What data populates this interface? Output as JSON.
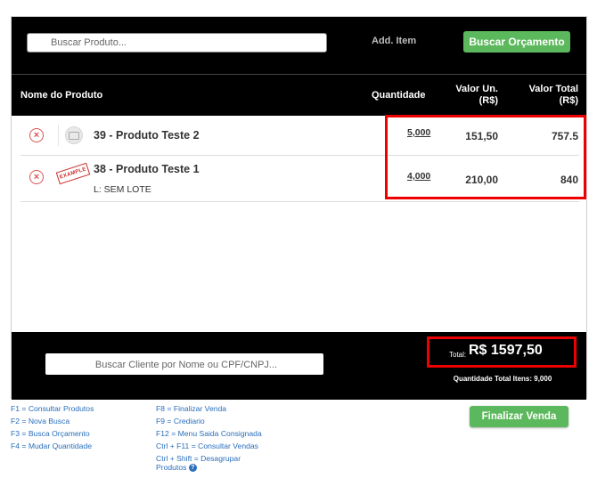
{
  "top": {
    "search_placeholder": "Buscar Produto...",
    "add_item_label": "Add. Item",
    "buscar_orcamento_label": "Buscar Orçamento"
  },
  "table": {
    "headers": {
      "nome": "Nome do Produto",
      "quantidade": "Quantidade",
      "valor_un_line1": "Valor Un.",
      "valor_un_line2": "(R$)",
      "valor_total_line1": "Valor Total",
      "valor_total_line2": "(R$)"
    },
    "rows": [
      {
        "name": "39 - Produto Teste 2",
        "lote": "",
        "qty": "5,000",
        "unit": "151,50",
        "total": "757.5",
        "remove_icon": "remove-circle-icon",
        "image_icon": "no-image-placeholder-icon"
      },
      {
        "name": "38 - Produto Teste 1",
        "lote": "L: SEM LOTE",
        "qty": "4,000",
        "unit": "210,00",
        "total": "840",
        "remove_icon": "remove-circle-icon",
        "image_icon": "example-stamp",
        "image_text": "EXAMPLE"
      }
    ]
  },
  "footer": {
    "cliente_placeholder": "Buscar Cliente por Nome ou CPF/CNPJ...",
    "total_label": "Total:",
    "total_value": "R$ 1597,50",
    "quantidade_total": "Quantidade Total Itens: 9,000"
  },
  "shortcuts_left": [
    "F1 = Consultar Produtos",
    "F2 = Nova Busca",
    "F3 = Busca Orçamento",
    "F4 = Mudar Quantidade"
  ],
  "shortcuts_right": [
    "F8 = Finalizar Venda",
    "F9 = Crediario",
    "F12 = Menu Saida Consignada",
    "Ctrl + F11 = Consultar Vendas",
    "Ctrl + Shift = Desagrupar",
    "Produtos"
  ],
  "finalizar_label": "Finalizar Venda",
  "colors": {
    "green": "#5cb85c",
    "highlight": "#ee0000",
    "remove": "#d9534f",
    "link": "#2a6ebb"
  }
}
